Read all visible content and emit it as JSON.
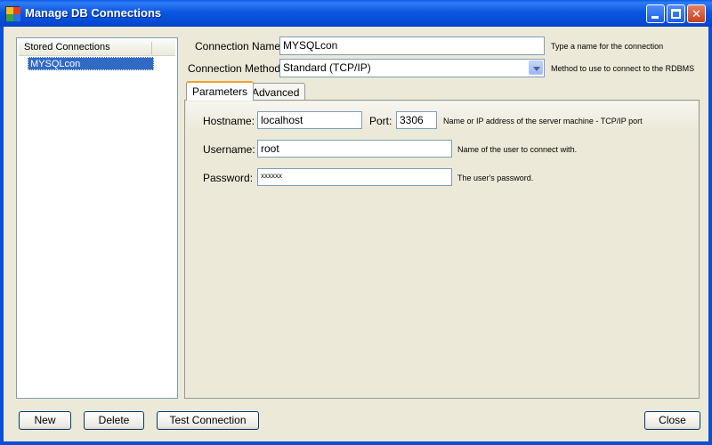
{
  "window": {
    "title": "Manage DB Connections"
  },
  "stored": {
    "header": "Stored Connections",
    "items": [
      "MYSQLcon"
    ]
  },
  "form": {
    "connection_name_label": "Connection Name:",
    "connection_name_value": "MYSQLcon",
    "connection_name_hint": "Type a name for the connection",
    "connection_method_label": "Connection Method:",
    "connection_method_value": "Standard (TCP/IP)",
    "connection_method_hint": "Method to use to connect to the RDBMS"
  },
  "tabs": [
    {
      "label": "Parameters",
      "active": true
    },
    {
      "label": "Advanced",
      "active": false
    }
  ],
  "params": {
    "hostname_label": "Hostname:",
    "hostname_value": "localhost",
    "port_label": "Port:",
    "port_value": "3306",
    "hostname_hint": "Name or IP address of the server machine - TCP/IP port",
    "username_label": "Username:",
    "username_value": "root",
    "username_hint": "Name of the user to connect with.",
    "password_label": "Password:",
    "password_value": "xxxxxx",
    "password_hint": "The user's password."
  },
  "buttons": {
    "new": "New",
    "delete": "Delete",
    "test": "Test Connection",
    "close": "Close"
  }
}
